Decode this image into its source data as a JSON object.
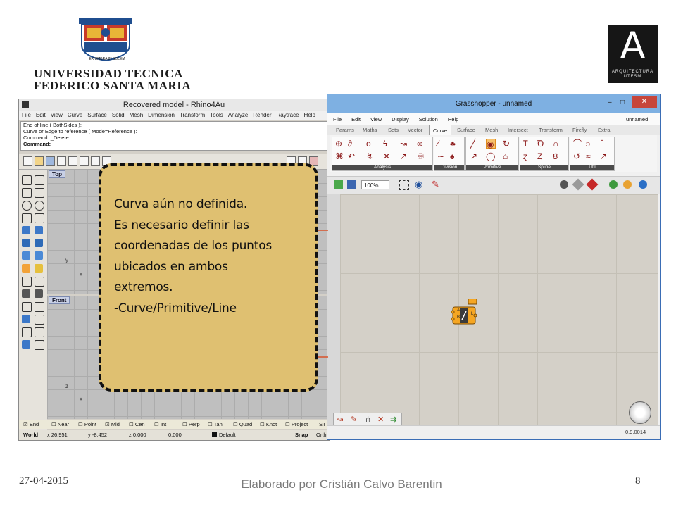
{
  "header": {
    "university_name_line1": "UNIVERSIDAD TECNICA",
    "university_name_line2": "FEDERICO SANTA MARIA",
    "crest_motto_left": "EX UMBRA",
    "crest_motto_mid": "IN",
    "crest_motto_right": "SOLEM",
    "faculty_logo_letter": "A",
    "faculty_logo_line1": "ARQUITECTURA",
    "faculty_logo_line2": "UTFSM"
  },
  "rhino": {
    "title": "Recovered model - Rhino4Au",
    "menu": [
      "File",
      "Edit",
      "View",
      "Curve",
      "Surface",
      "Solid",
      "Mesh",
      "Dimension",
      "Transform",
      "Tools",
      "Analyze",
      "Render",
      "Raytrace",
      "Help"
    ],
    "command_history": [
      "End of line ( BothSides ):",
      "Curve or Edge to reference ( Mode=Reference ):",
      "Command: _Delete"
    ],
    "command_prompt": "Command:",
    "viewport_top": "Top",
    "viewport_front": "Front",
    "axis_x": "x",
    "axis_y": "y",
    "axis_z": "z",
    "snaps": [
      {
        "label": "End",
        "checked": true
      },
      {
        "label": "Near",
        "checked": false
      },
      {
        "label": "Point",
        "checked": false
      },
      {
        "label": "Mid",
        "checked": true
      },
      {
        "label": "Cen",
        "checked": false
      },
      {
        "label": "Int",
        "checked": false
      },
      {
        "label": "Perp",
        "checked": false
      },
      {
        "label": "Tan",
        "checked": false
      },
      {
        "label": "Quad",
        "checked": false
      },
      {
        "label": "Knot",
        "checked": false
      },
      {
        "label": "Project",
        "checked": false
      }
    ],
    "snaps_tail": "ST",
    "status": {
      "world": "World",
      "x": "x 26.951",
      "y": "y -8.452",
      "z": "z 0.000",
      "extra": "0.000",
      "layer": "Default",
      "snap": "Snap",
      "ortho": "Orth"
    }
  },
  "grasshopper": {
    "title": "Grasshopper - unnamed",
    "minimize": "–",
    "maximize": "□",
    "close": "✕",
    "menu": [
      "File",
      "Edit",
      "View",
      "Display",
      "Solution",
      "Help"
    ],
    "document_name": "unnamed",
    "tabs": [
      "Params",
      "Maths",
      "Sets",
      "Vector",
      "Curve",
      "Surface",
      "Mesh",
      "Intersect",
      "Transform",
      "Firefly",
      "Extra"
    ],
    "active_tab": "Curve",
    "ribbon_groups": [
      "Analysis",
      "Division",
      "Primitive",
      "Spline",
      "Util"
    ],
    "zoom": "100%",
    "component": {
      "inputs": [
        "A",
        "B"
      ],
      "output": "L"
    },
    "version": "0.9.0014"
  },
  "callout": {
    "lines": [
      "Curva aún no definida.",
      "Es necesario definir las",
      "coordenadas de los puntos",
      "ubicados en ambos",
      "extremos.",
      "-Curve/Primitive/Line"
    ]
  },
  "footer": {
    "date": "27-04-2015",
    "author": "Elaborado por Cristián Calvo Barentin",
    "page_number": "8"
  },
  "colors": {
    "callout_fill": "#dfc071",
    "ui_blue_title": "#7eb0e2",
    "rhino_gray": "#d4d0c8",
    "line_green": "#4caf50",
    "line_red": "#d9542c"
  }
}
